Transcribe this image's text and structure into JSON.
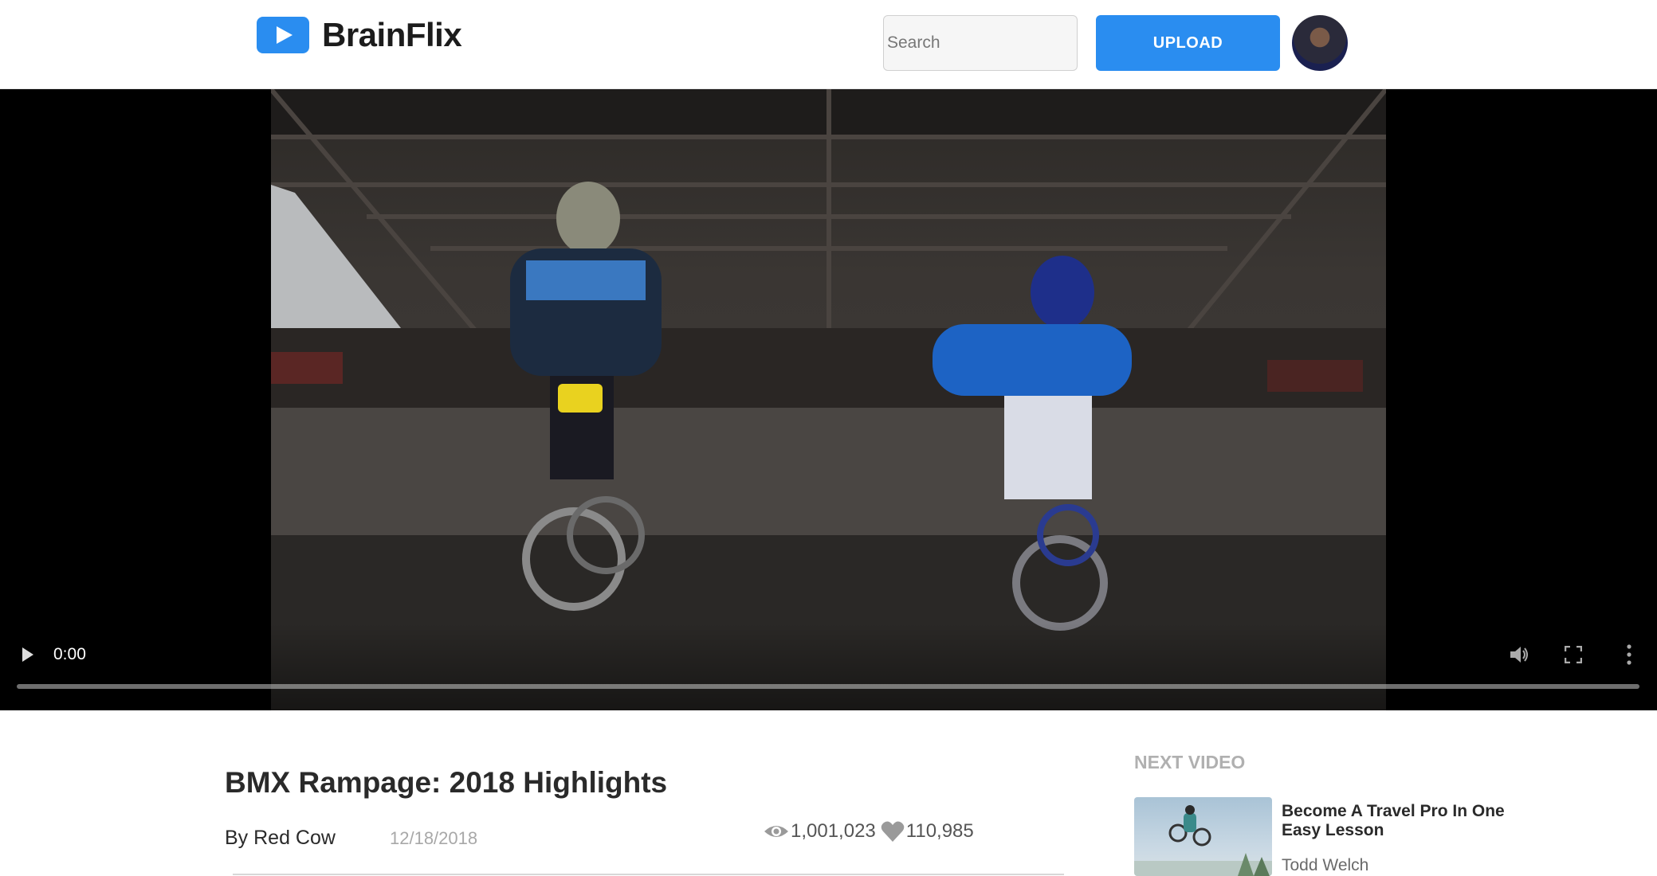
{
  "header": {
    "brand": "BrainFlix",
    "search_placeholder": "Search",
    "upload_label": "UPLOAD",
    "accent_color": "#2a8df0"
  },
  "player": {
    "current_time": "0:00",
    "progress": 0
  },
  "video": {
    "title": "BMX Rampage: 2018 Highlights",
    "author": "By Red Cow",
    "date": "12/18/2018",
    "views": "1,001,023",
    "likes": "110,985"
  },
  "sidebar": {
    "heading": "NEXT VIDEO",
    "items": [
      {
        "title": "Become A Travel Pro In One Easy Lesson",
        "author": "Todd Welch"
      }
    ]
  }
}
